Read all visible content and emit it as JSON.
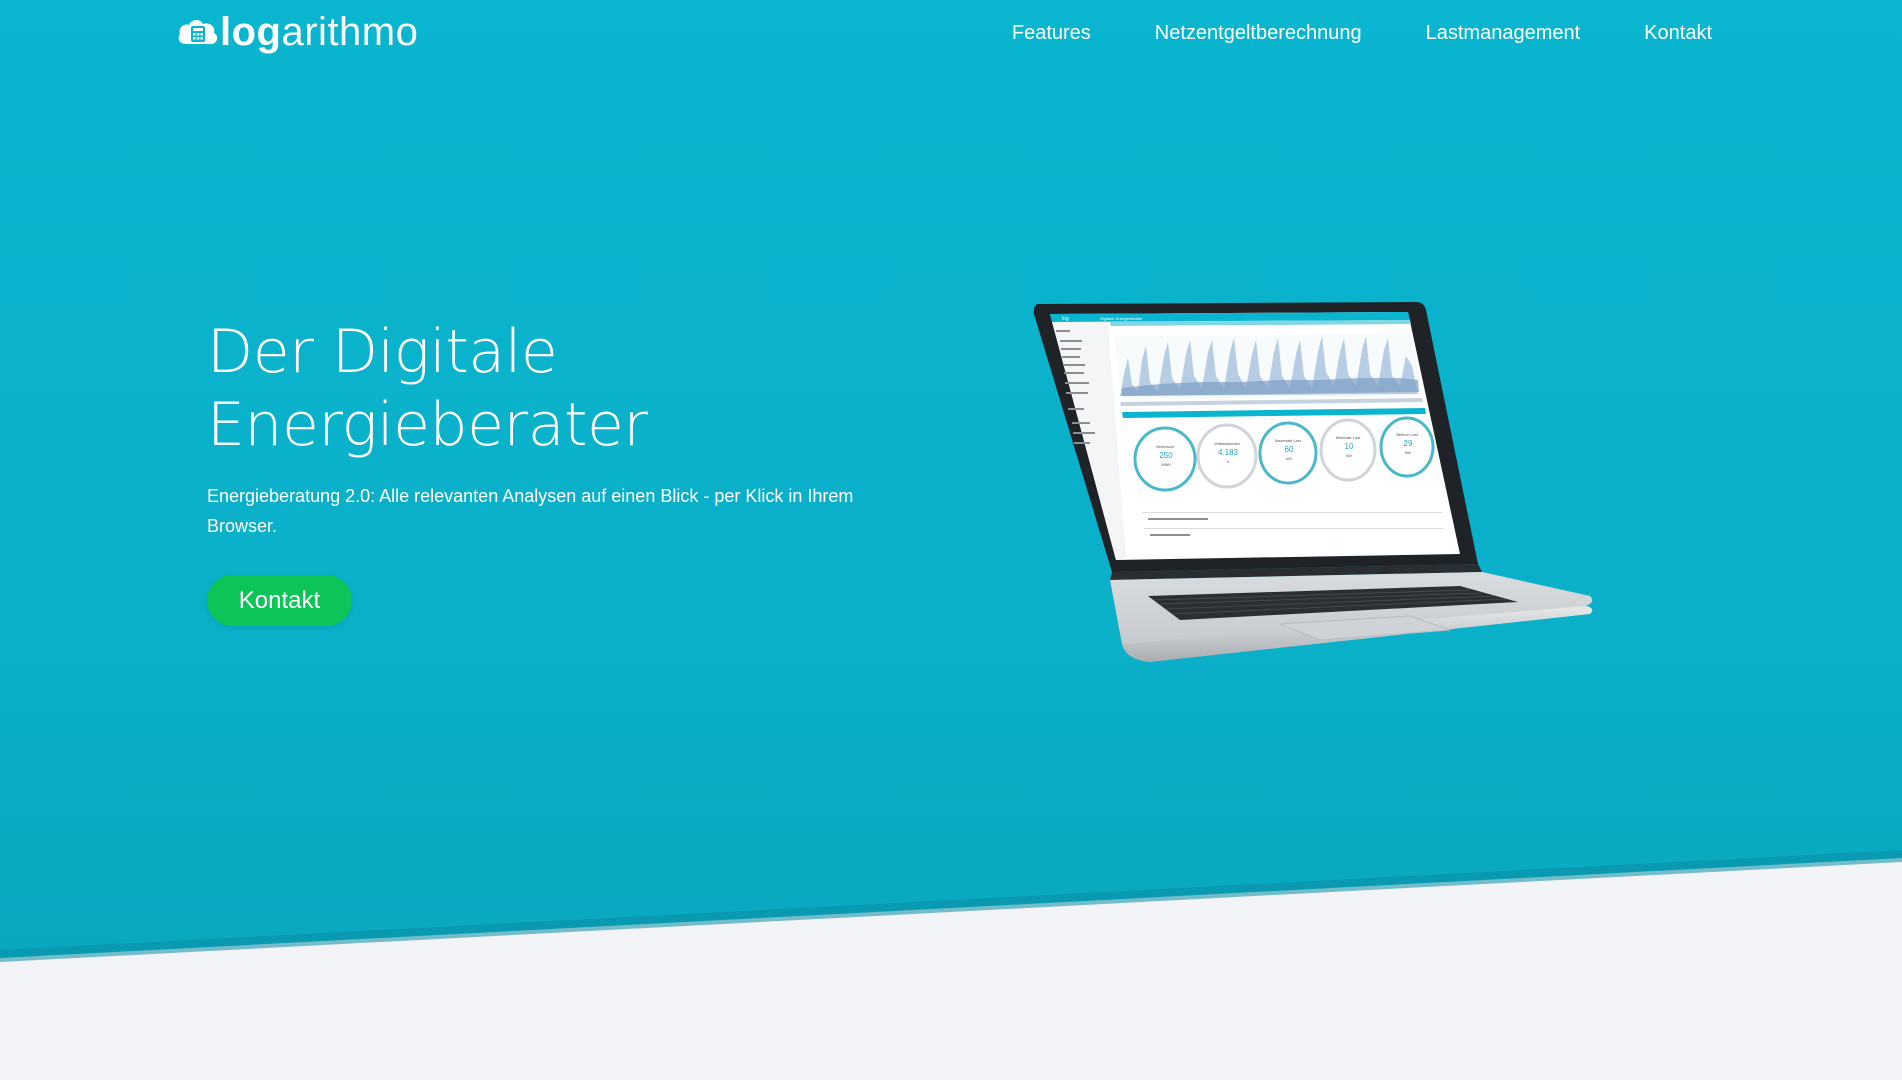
{
  "nav": {
    "logo_bold": "log",
    "logo_light": "arithmo",
    "links": [
      "Features",
      "Netzentgeltberechnung",
      "Lastmanagement",
      "Kontakt"
    ]
  },
  "hero": {
    "title_line1": "Der Digitale",
    "title_line2": "Energieberater",
    "subtitle": "Energieberatung 2.0: Alle relevanten Analysen auf einen Blick - per Klick in Ihrem Browser.",
    "cta_label": "Kontakt"
  },
  "dashboard": {
    "header": "Digitaler Energieberater",
    "gauges": [
      {
        "label": "Verbrauch",
        "value": "250",
        "unit": "MWh"
      },
      {
        "label": "Vollaststunden",
        "value": "4.183",
        "unit": "h"
      },
      {
        "label": "Maximale Last",
        "value": "60",
        "unit": "kW"
      },
      {
        "label": "Minimale Last",
        "value": "10",
        "unit": "kW"
      },
      {
        "label": "Mittlere Last",
        "value": "29",
        "unit": "kW"
      }
    ]
  },
  "colors": {
    "hero_bg": "#09b5cf",
    "cta_green": "#0cc457",
    "below_bg": "#f3f4f8"
  }
}
